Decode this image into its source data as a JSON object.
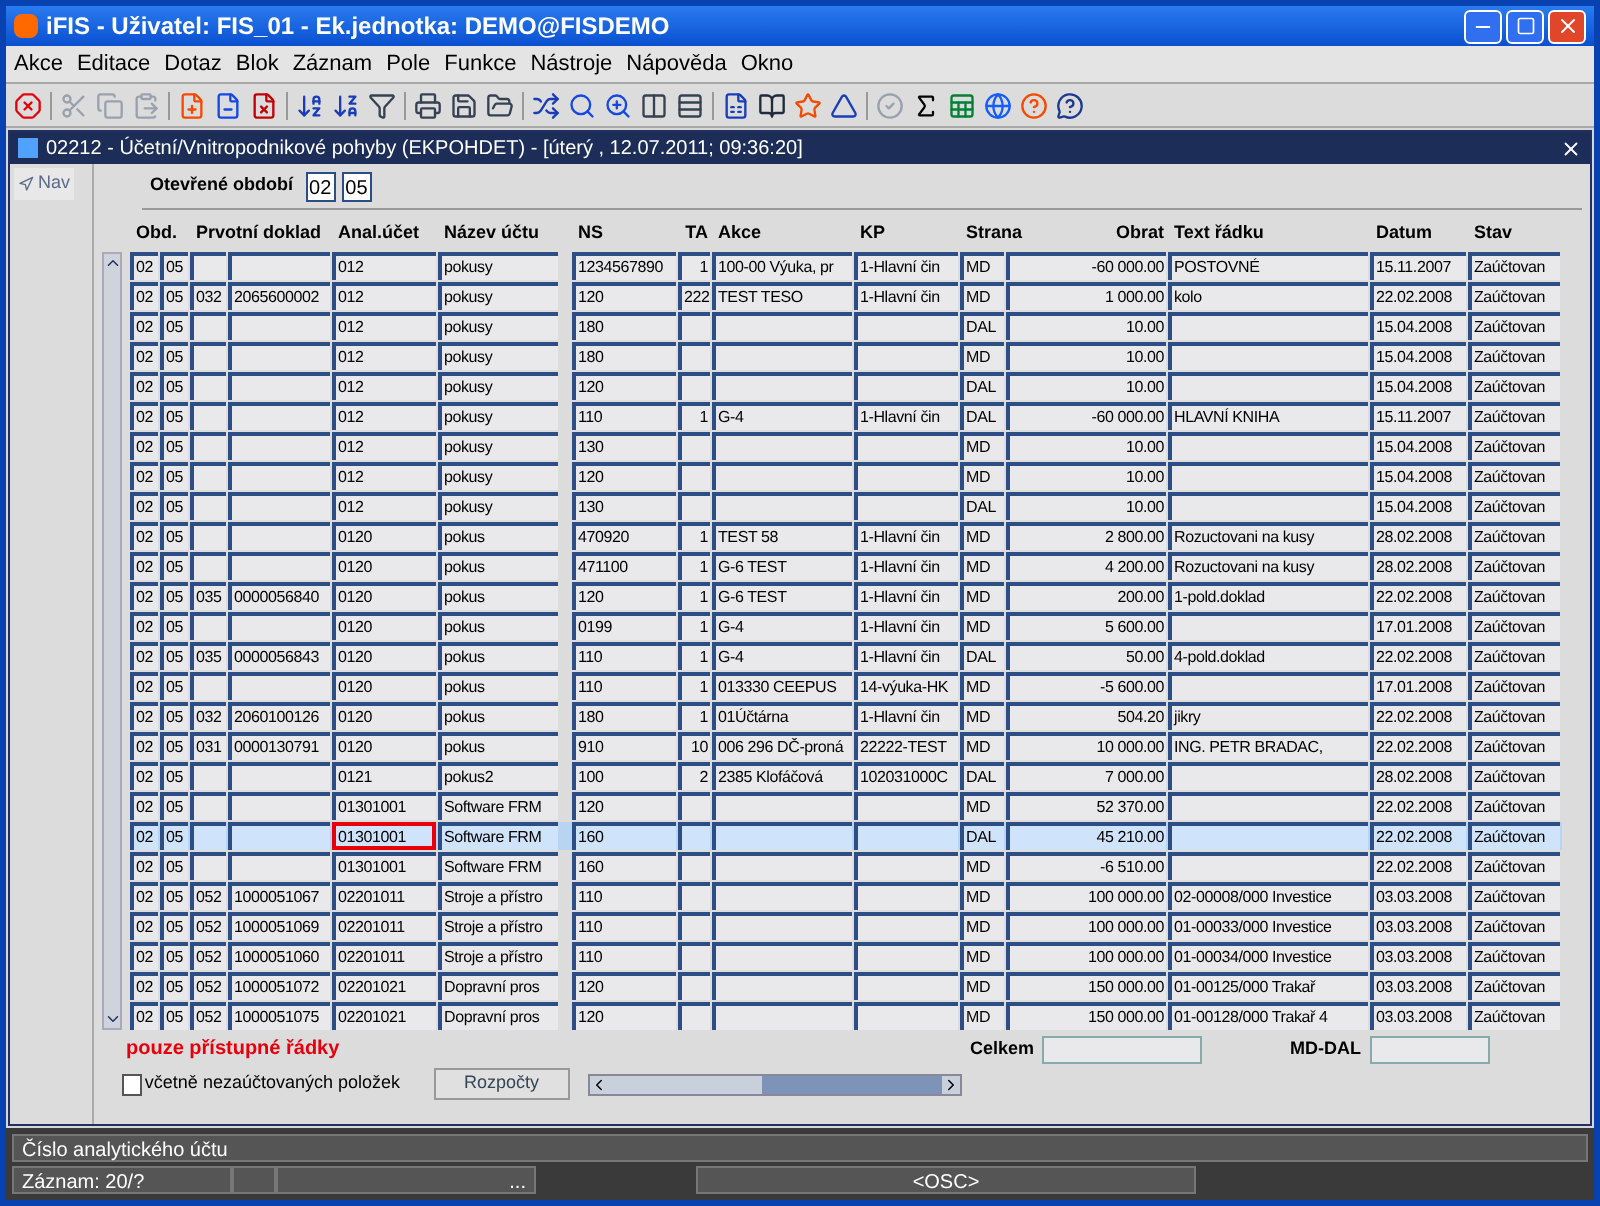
{
  "window": {
    "title": "iFIS - Uživatel: FIS_01 - Ek.jednotka: DEMO@FISDEMO"
  },
  "menu": [
    "Akce",
    "Editace",
    "Dotaz",
    "Blok",
    "Záznam",
    "Pole",
    "Funkce",
    "Nástroje",
    "Nápověda",
    "Okno"
  ],
  "inner_window": {
    "title": "02212 - Účetní/Vnitropodnikové pohyby (EKPOHDET) - [úterý , 12.07.2011; 09:36:20]"
  },
  "nav_button": "Nav",
  "filter": {
    "label": "Otevřené období",
    "values": [
      "02",
      "05"
    ]
  },
  "table": {
    "columns": [
      "Obd.",
      "Prvotní doklad",
      "Anal.účet",
      "Název účtu",
      "NS",
      "TA",
      "Akce",
      "KP",
      "Strana",
      "Obrat",
      "Text řádku",
      "Datum",
      "Stav"
    ],
    "rows": [
      {
        "selected": false,
        "focused": false,
        "cells": [
          [
            "02",
            "05"
          ],
          [
            "",
            ""
          ],
          "012",
          "pokusy",
          "1234567890",
          "1",
          "100-00 Výuka, pr",
          "1-Hlavní čin",
          "MD",
          "-60 000.00",
          "POSTOVNÉ",
          "15.11.2007",
          "Zaúčtovan"
        ]
      },
      {
        "selected": false,
        "focused": false,
        "cells": [
          [
            "02",
            "05"
          ],
          [
            "032",
            "2065600002"
          ],
          "012",
          "pokusy",
          "120",
          "222",
          "TEST TESO",
          "1-Hlavní čin",
          "MD",
          "1 000.00",
          "kolo",
          "22.02.2008",
          "Zaúčtovan"
        ]
      },
      {
        "selected": false,
        "focused": false,
        "cells": [
          [
            "02",
            "05"
          ],
          [
            "",
            ""
          ],
          "012",
          "pokusy",
          "180",
          "",
          "",
          "",
          "DAL",
          "10.00",
          "",
          "15.04.2008",
          "Zaúčtovan"
        ]
      },
      {
        "selected": false,
        "focused": false,
        "cells": [
          [
            "02",
            "05"
          ],
          [
            "",
            ""
          ],
          "012",
          "pokusy",
          "180",
          "",
          "",
          "",
          "MD",
          "10.00",
          "",
          "15.04.2008",
          "Zaúčtovan"
        ]
      },
      {
        "selected": false,
        "focused": false,
        "cells": [
          [
            "02",
            "05"
          ],
          [
            "",
            ""
          ],
          "012",
          "pokusy",
          "120",
          "",
          "",
          "",
          "DAL",
          "10.00",
          "",
          "15.04.2008",
          "Zaúčtovan"
        ]
      },
      {
        "selected": false,
        "focused": false,
        "cells": [
          [
            "02",
            "05"
          ],
          [
            "",
            ""
          ],
          "012",
          "pokusy",
          "110",
          "1",
          "G-4",
          "1-Hlavní čin",
          "DAL",
          "-60 000.00",
          "HLAVNÍ KNIHA",
          "15.11.2007",
          "Zaúčtovan"
        ]
      },
      {
        "selected": false,
        "focused": false,
        "cells": [
          [
            "02",
            "05"
          ],
          [
            "",
            ""
          ],
          "012",
          "pokusy",
          "130",
          "",
          "",
          "",
          "MD",
          "10.00",
          "",
          "15.04.2008",
          "Zaúčtovan"
        ]
      },
      {
        "selected": false,
        "focused": false,
        "cells": [
          [
            "02",
            "05"
          ],
          [
            "",
            ""
          ],
          "012",
          "pokusy",
          "120",
          "",
          "",
          "",
          "MD",
          "10.00",
          "",
          "15.04.2008",
          "Zaúčtovan"
        ]
      },
      {
        "selected": false,
        "focused": false,
        "cells": [
          [
            "02",
            "05"
          ],
          [
            "",
            ""
          ],
          "012",
          "pokusy",
          "130",
          "",
          "",
          "",
          "DAL",
          "10.00",
          "",
          "15.04.2008",
          "Zaúčtovan"
        ]
      },
      {
        "selected": false,
        "focused": false,
        "cells": [
          [
            "02",
            "05"
          ],
          [
            "",
            ""
          ],
          "0120",
          "pokus",
          "470920",
          "1",
          "TEST 58",
          "1-Hlavní čin",
          "MD",
          "2 800.00",
          "Rozuctovani na kusy",
          "28.02.2008",
          "Zaúčtovan"
        ]
      },
      {
        "selected": false,
        "focused": false,
        "cells": [
          [
            "02",
            "05"
          ],
          [
            "",
            ""
          ],
          "0120",
          "pokus",
          "471100",
          "1",
          "G-6 TEST",
          "1-Hlavní čin",
          "MD",
          "4 200.00",
          "Rozuctovani na kusy",
          "28.02.2008",
          "Zaúčtovan"
        ]
      },
      {
        "selected": false,
        "focused": false,
        "cells": [
          [
            "02",
            "05"
          ],
          [
            "035",
            "0000056840"
          ],
          "0120",
          "pokus",
          "120",
          "1",
          "G-6 TEST",
          "1-Hlavní čin",
          "MD",
          "200.00",
          "1-pold.doklad",
          "22.02.2008",
          "Zaúčtovan"
        ]
      },
      {
        "selected": false,
        "focused": false,
        "cells": [
          [
            "02",
            "05"
          ],
          [
            "",
            ""
          ],
          "0120",
          "pokus",
          "0199",
          "1",
          "G-4",
          "1-Hlavní čin",
          "MD",
          "5 600.00",
          "",
          "17.01.2008",
          "Zaúčtovan"
        ]
      },
      {
        "selected": false,
        "focused": false,
        "cells": [
          [
            "02",
            "05"
          ],
          [
            "035",
            "0000056843"
          ],
          "0120",
          "pokus",
          "110",
          "1",
          "G-4",
          "1-Hlavní čin",
          "DAL",
          "50.00",
          "4-pold.doklad",
          "22.02.2008",
          "Zaúčtovan"
        ]
      },
      {
        "selected": false,
        "focused": false,
        "cells": [
          [
            "02",
            "05"
          ],
          [
            "",
            ""
          ],
          "0120",
          "pokus",
          "110",
          "1",
          "013330 CEEPUS",
          "14-výuka-HK",
          "MD",
          "-5 600.00",
          "",
          "17.01.2008",
          "Zaúčtovan"
        ]
      },
      {
        "selected": false,
        "focused": false,
        "cells": [
          [
            "02",
            "05"
          ],
          [
            "032",
            "2060100126"
          ],
          "0120",
          "pokus",
          "180",
          "1",
          "01Účtárna",
          "1-Hlavní čin",
          "MD",
          "504.20",
          "jikry",
          "22.02.2008",
          "Zaúčtovan"
        ]
      },
      {
        "selected": false,
        "focused": false,
        "cells": [
          [
            "02",
            "05"
          ],
          [
            "031",
            "0000130791"
          ],
          "0120",
          "pokus",
          "910",
          "10",
          "006 296 DČ-proná",
          "22222-TEST",
          "MD",
          "10 000.00",
          "ING. PETR BRADAC,",
          "22.02.2008",
          "Zaúčtovan"
        ]
      },
      {
        "selected": false,
        "focused": false,
        "cells": [
          [
            "02",
            "05"
          ],
          [
            "",
            ""
          ],
          "0121",
          "pokus2",
          "100",
          "2",
          "2385 Klofáčová",
          "102031000C",
          "DAL",
          "7 000.00",
          "",
          "28.02.2008",
          "Zaúčtovan"
        ]
      },
      {
        "selected": false,
        "focused": false,
        "cells": [
          [
            "02",
            "05"
          ],
          [
            "",
            ""
          ],
          "01301001",
          "Software FRM",
          "120",
          "",
          "",
          "",
          "MD",
          "52 370.00",
          "",
          "22.02.2008",
          "Zaúčtovan"
        ]
      },
      {
        "selected": true,
        "focused": true,
        "cells": [
          [
            "02",
            "05"
          ],
          [
            "",
            ""
          ],
          "01301001",
          "Software FRM",
          "160",
          "",
          "",
          "",
          "DAL",
          "45 210.00",
          "",
          "22.02.2008",
          "Zaúčtovan"
        ]
      },
      {
        "selected": false,
        "focused": false,
        "cells": [
          [
            "02",
            "05"
          ],
          [
            "",
            ""
          ],
          "01301001",
          "Software FRM",
          "160",
          "",
          "",
          "",
          "MD",
          "-6 510.00",
          "",
          "22.02.2008",
          "Zaúčtovan"
        ]
      },
      {
        "selected": false,
        "focused": false,
        "cells": [
          [
            "02",
            "05"
          ],
          [
            "052",
            "1000051067"
          ],
          "02201011",
          "Stroje a přístro",
          "110",
          "",
          "",
          "",
          "MD",
          "100 000.00",
          "02-00008/000 Investice",
          "03.03.2008",
          "Zaúčtovan"
        ]
      },
      {
        "selected": false,
        "focused": false,
        "cells": [
          [
            "02",
            "05"
          ],
          [
            "052",
            "1000051069"
          ],
          "02201011",
          "Stroje a přístro",
          "110",
          "",
          "",
          "",
          "MD",
          "100 000.00",
          "01-00033/000 Investice",
          "03.03.2008",
          "Zaúčtovan"
        ]
      },
      {
        "selected": false,
        "focused": false,
        "cells": [
          [
            "02",
            "05"
          ],
          [
            "052",
            "1000051060"
          ],
          "02201011",
          "Stroje a přístro",
          "110",
          "",
          "",
          "",
          "MD",
          "100 000.00",
          "01-00034/000 Investice",
          "03.03.2008",
          "Zaúčtovan"
        ]
      },
      {
        "selected": false,
        "focused": false,
        "cells": [
          [
            "02",
            "05"
          ],
          [
            "052",
            "1000051072"
          ],
          "02201021",
          "Dopravní pros",
          "120",
          "",
          "",
          "",
          "MD",
          "150 000.00",
          "01-00125/000 Trakař",
          "03.03.2008",
          "Zaúčtovan"
        ]
      },
      {
        "selected": false,
        "focused": false,
        "cells": [
          [
            "02",
            "05"
          ],
          [
            "052",
            "1000051075"
          ],
          "02201021",
          "Dopravní pros",
          "120",
          "",
          "",
          "",
          "MD",
          "150 000.00",
          "01-00128/000 Trakař 4",
          "03.03.2008",
          "Zaúčtovan"
        ]
      }
    ]
  },
  "footer": {
    "note": "pouze přístupné řádky",
    "checkbox": {
      "label": "včetně nezaúčtovaných položek",
      "checked": false
    },
    "button": "Rozpočty",
    "total_label": "Celkem",
    "diff_label": "MD-DAL"
  },
  "status_bar": {
    "hint": "Číslo analytického účtu",
    "record": "Záznam: 20/?",
    "segments": [
      "...",
      "<OSC>"
    ]
  }
}
